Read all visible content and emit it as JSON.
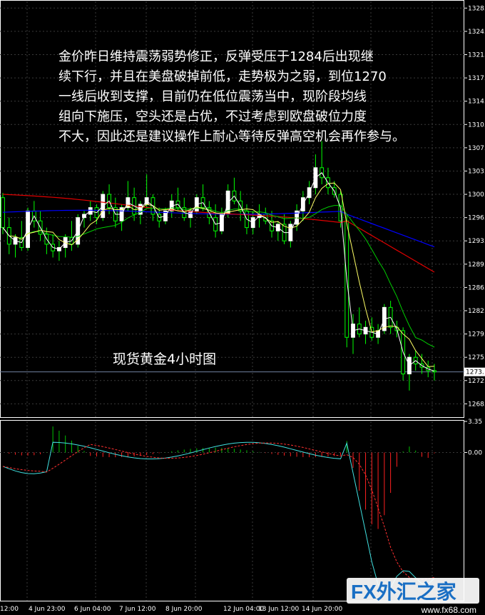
{
  "annotation": {
    "lines": [
      "金价昨日维持震荡弱势修正，反弹受压于1284后出现继",
      "续下行，并且在美盘破掉前低，走势极为之弱，到位1270",
      "一线后收到支撑，目前仍在低位震荡当中，现阶段均线",
      "组向下施压，空头还是占优，不过考虑到欧盘破位力度",
      "不大，因此还是建议操作上耐心等待反弹高空机会再作参与。"
    ]
  },
  "caption": "现货黄金4小时图",
  "watermark": {
    "brand": "FX外汇之家",
    "site": "www.fx68.com"
  },
  "colors": {
    "background": "#000000",
    "bull": "#ffffff",
    "bear": "#00ff00",
    "ma_white": "#ffffff",
    "ma_yellow": "#ffff66",
    "ma_green": "#00cc00",
    "ma_red": "#e00000",
    "ma_blue": "#0000ff",
    "macd_up": "#00c000",
    "macd_down": "#ff2020",
    "macd_line": "#40e0e0",
    "signal_line": "#ff3030",
    "price_line": "#7080a0"
  },
  "chart_data": [
    {
      "type": "candlestick",
      "title": "",
      "y_ticks": [
        "1328.",
        "1324.",
        "1321.",
        "1317.",
        "1314.",
        "1310.",
        "1307.",
        "1303.",
        "1300.",
        "1296.",
        "1293.",
        "1289.",
        "1286.",
        "1282.",
        "1279.",
        "1275.",
        "1272.",
        "1268."
      ],
      "ylim": [
        1266.5,
        1329
      ],
      "current_price_label": "1273.",
      "x_labels": [
        "12:00",
        "4 Jun 23:00",
        "6 Jun 04:00",
        "7 Jun 12:00",
        "8 Jun 20:00",
        "12 Jun 04:00",
        "13 Jun 12:00",
        "14 Jun 20:00"
      ],
      "moving_averages": [
        "white",
        "yellow",
        "green",
        "red",
        "blue"
      ],
      "description": "4H gold candles with five moving averages; range trading around 1296–1303, then sharp drop to ~1270 area"
    },
    {
      "type": "macd",
      "y_ticks": [
        "3.35",
        "0.00"
      ],
      "series": [
        "histogram",
        "macd line",
        "signal line"
      ]
    }
  ]
}
